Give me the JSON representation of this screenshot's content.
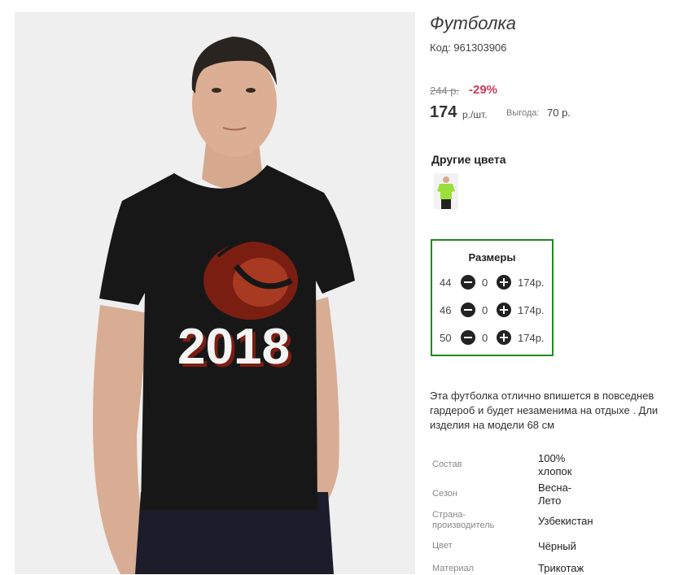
{
  "product": {
    "title": "Футболка",
    "code": "Код: 961303906",
    "old_price": "244 р.",
    "discount": "-29%",
    "price": "174",
    "unit": "р./шт.",
    "benefit_label": "Выгода:",
    "benefit_value": "70 р.",
    "shirt_print": "2018"
  },
  "other_colors": {
    "heading": "Другие цвета",
    "thumb_color": "#9be03a"
  },
  "sizes": {
    "heading": "Размеры",
    "rows": [
      {
        "size": "44",
        "qty": "0",
        "price": "174р."
      },
      {
        "size": "46",
        "qty": "0",
        "price": "174р."
      },
      {
        "size": "50",
        "qty": "0",
        "price": "174р."
      }
    ],
    "border_color": "#1e8a1e"
  },
  "description": "Эта футболка отлично впишется в повседнев\nгардероб и будет незаменима на отдыхе . Дли\nизделия на модели 68 см",
  "specs": [
    {
      "label": "Состав",
      "value": "100%\nхлопок"
    },
    {
      "label": "Сезон",
      "value": "Весна-\nЛето"
    },
    {
      "label": "Страна-\nпроизводитель",
      "value": "Узбекистан"
    },
    {
      "label": "Цвет",
      "value": "Чёрный"
    },
    {
      "label": "Материал",
      "value": "Трикотаж"
    }
  ],
  "colors": {
    "discount": "#d03a5a",
    "shirt": "#161616",
    "emblem": "#7a1e12"
  }
}
